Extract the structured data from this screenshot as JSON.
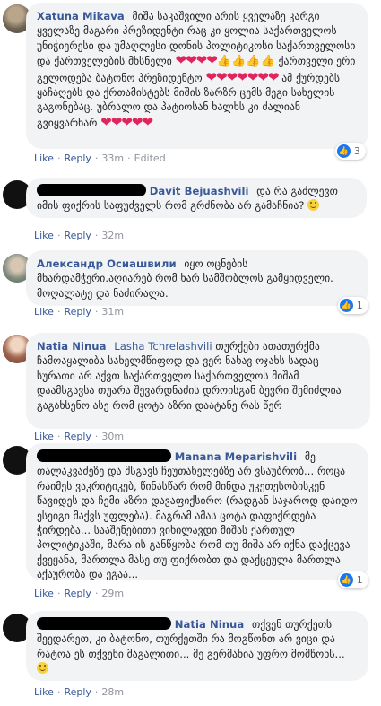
{
  "actions": {
    "like": "Like",
    "reply": "Reply",
    "dot": "·",
    "edited": "Edited"
  },
  "comments": [
    {
      "author": "Xatuna Mikava",
      "text1": "მიშა საკაშვილი არის ყველაზე კარგი ყველაზე მაგარი პრეზიდენტი რაც კი ყოლია საქართველოს უნიჭიერესი და უმაღლესი დონის პოლიტიკოსი საქართველოსი და ქართველების მხსნელი",
      "text2": "ქართველი ერი გელოდება ბატონო პრეზიდენტო",
      "text3": "ამ ქურდებს ყაჩაღებს და ქრთამისტებს მიშის ზარზრ ცემს მეგი სახელის გაგონებაც. უბრალო და პატიოსან ხალხს კი ძალიან გვიყვარხარ",
      "time": "33m",
      "reaction_count": "3"
    },
    {
      "author": "Davit Bejuashvili",
      "text": "და რა გაძლევთ იმის ფიქრის საფუძველს რომ გრძნობა არ გამაჩნია?",
      "time": "32m"
    },
    {
      "author": "Александр Осиашвили",
      "text": "იყო ოცნების მხარდამჭერი.აღიარებ რომ ხარ სამშობლოს გამყიდველი. მოღალატე და ნაძირალა.",
      "time": "31m",
      "reaction_count": "1"
    },
    {
      "author": "Natia Ninua",
      "tag": "Lasha Tchrelashvili",
      "text": "თურქები ათათურქმა ჩამოაყალიბა სახელმწიფოდ და ვერ ნახავ ოჯახს სადაც სურათი არ აქვთ საქართველო საქართველოს მიშამ დაამსგავსა თუარა შევარდნაძის დროისგან ბევრი შემიძლია გაგახსენო ასე რომ ცოტა აზრი დაატანე რას წერ",
      "time": "30m"
    },
    {
      "author": "Manana Meparishvili",
      "text": "მე თალაკვაძეზე და მსგავს ჩეუთახელებზე არ ვსაუბრობ... როცა რაიმეს ვაკრიტიკებ, წინასწარ რომ მინდა უკეთესობისკენ წავიდეს და ჩემი აზრი დავაფიქსირო (რადგან საჯაროდ დაიდო ესეიგი მაქვს უფლება). მაგრამ ამას ცოტა დაფიქრდება ჭირდება... სააშენებითი ვიხილავდი მიშას ქართულ პოლიტიკაში, მარა ის განწყობა რომ თუ მიშა არ იქნა დაქცევა ქვეყანა, მართლა მასე თუ ფიქრობთ და დაქცეულა მართლა აქაურობა და ეგაა...",
      "time": "29m",
      "reaction_count": "1"
    },
    {
      "author": "Natia Ninua",
      "text": "თქვენ თურქეთს შეედარეთ, კი ბატონო, თურქეთში რა მოგწონთ არ ვიცი და რატოა ეს თქვენი მაგალითი... მე გერმანია უფრო მომწონს...",
      "time": "28m"
    }
  ]
}
